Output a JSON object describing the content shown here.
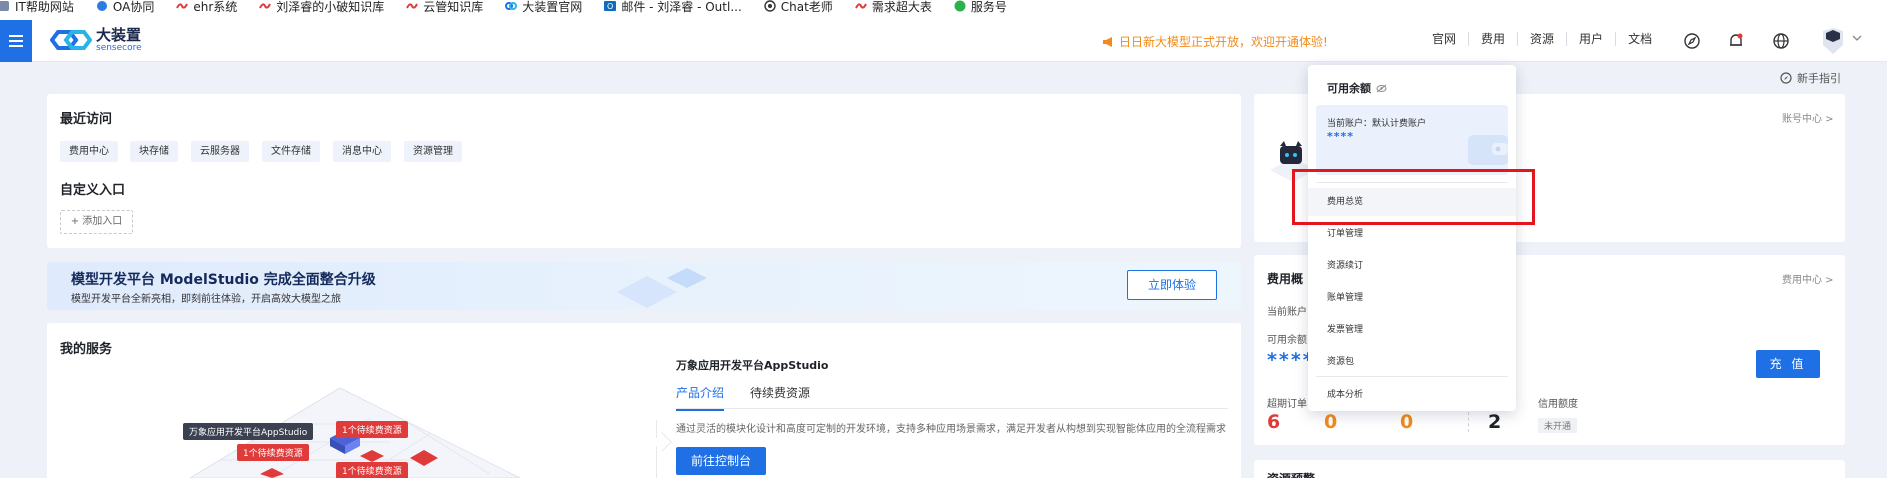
{
  "bookmarks": [
    {
      "label": "IT帮助网站",
      "icon": "bookmark-icon"
    },
    {
      "label": "OA协同",
      "icon": "oa-icon"
    },
    {
      "label": "ehr系统",
      "icon": "ehr-icon"
    },
    {
      "label": "刘泽睿的小破知识库",
      "icon": "kb-icon"
    },
    {
      "label": "云管知识库",
      "icon": "kb-icon"
    },
    {
      "label": "大装置官网",
      "icon": "sensecore-icon"
    },
    {
      "label": "邮件 - 刘泽睿 - Outl...",
      "icon": "outlook-icon"
    },
    {
      "label": "Chat老师",
      "icon": "chatgpt-icon"
    },
    {
      "label": "需求超大表",
      "icon": "kb-icon"
    },
    {
      "label": "服务号",
      "icon": "wechat-icon"
    }
  ],
  "header": {
    "logo_cn": "大装置",
    "logo_en": "sensecore",
    "notice": "日日新大模型正式开放，欢迎开通体验!",
    "nav": [
      "官网",
      "费用",
      "资源",
      "用户",
      "文档"
    ],
    "accent": "#1f6fe5"
  },
  "guide": "新手指引",
  "recent": {
    "title": "最近访问",
    "chips": [
      "费用中心",
      "块存储",
      "云服务器",
      "文件存储",
      "消息中心",
      "资源管理"
    ],
    "custom_title": "自定义入口",
    "add_label": "+ 添加入口"
  },
  "banner": {
    "title": "模型开发平台 ModelStudio 完成全面整合升级",
    "subtitle": "模型开发平台全新亮相，即刻前往体验，开启高效大模型之旅",
    "button": "立即体验"
  },
  "services": {
    "title": "我的服务",
    "product_title": "万象应用开发平台AppStudio",
    "tabs": [
      "产品介绍",
      "待续费资源"
    ],
    "description": "通过灵活的模块化设计和高度可定制的开发环境，支持多种应用场景需求，满足开发者从构想到实现智能体应用的全流程需求",
    "button": "前往控制台",
    "iso_labels": {
      "app": "万象应用开发平台AppStudio",
      "pending_1": "1个待续费资源",
      "pending_2": "1个待续费资源",
      "pending_3": "1个待续费资源"
    }
  },
  "right": {
    "account_link": "账号中心 >",
    "fee_title": "费用概",
    "fee_link": "费用中心 >",
    "current_account": "当前账户：",
    "available_prefix": "可用余额",
    "balance_masked": "****",
    "recharge": "充 值",
    "overdue_label": "超期订单",
    "credit_label": "信用额度",
    "counts": [
      "6",
      "0",
      "0",
      "2"
    ],
    "credit_status": "未开通",
    "resource_title": "资源预警"
  },
  "dropdown": {
    "title": "可用余额",
    "account_label": "当前账户：默认计费账户",
    "balance_masked": "****",
    "items": [
      "费用总览",
      "订单管理",
      "资源续订",
      "账单管理",
      "发票管理",
      "资源包",
      "成本分析"
    ]
  },
  "colors": {
    "primary": "#1f6fe5",
    "orange": "#f08b1c",
    "red_num": "#e03b3b",
    "highlight_border": "#e5151d"
  }
}
